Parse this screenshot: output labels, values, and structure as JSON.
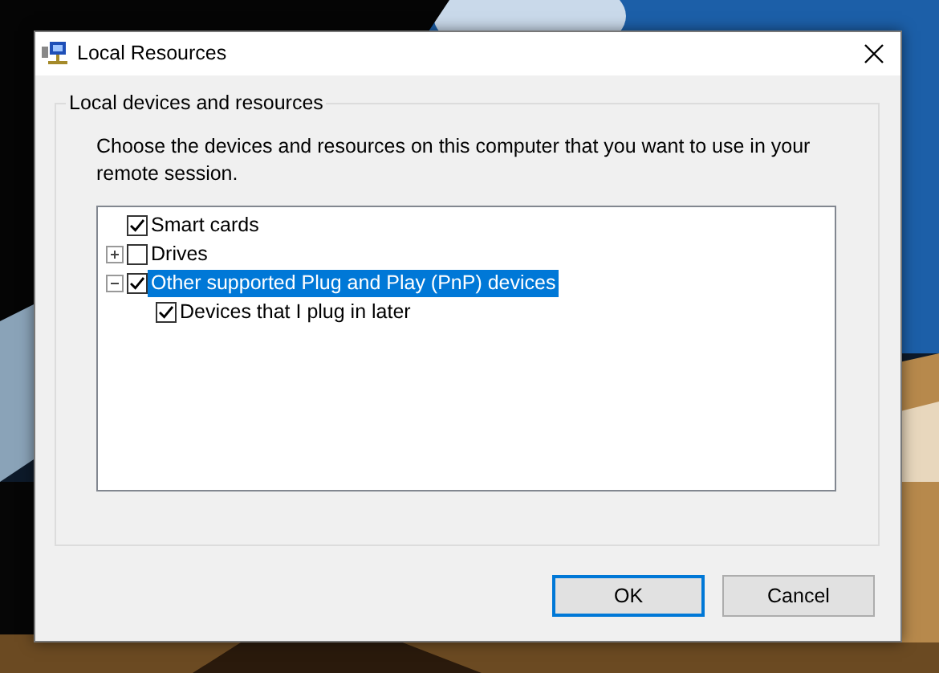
{
  "window": {
    "title": "Local Resources"
  },
  "group": {
    "title": "Local devices and resources",
    "description": "Choose the devices and resources on this computer that you want to use in your remote session."
  },
  "tree": [
    {
      "label": "Smart cards",
      "checked": true,
      "selected": false
    },
    {
      "label": "Drives",
      "checked": false,
      "selected": false,
      "expanded": false
    },
    {
      "label": "Other supported Plug and Play (PnP) devices",
      "checked": true,
      "selected": true,
      "expanded": true,
      "children": [
        {
          "label": "Devices that I plug in later",
          "checked": true,
          "selected": false
        }
      ]
    }
  ],
  "buttons": [
    {
      "label": "OK",
      "default": true
    },
    {
      "label": "Cancel",
      "default": false
    }
  ]
}
